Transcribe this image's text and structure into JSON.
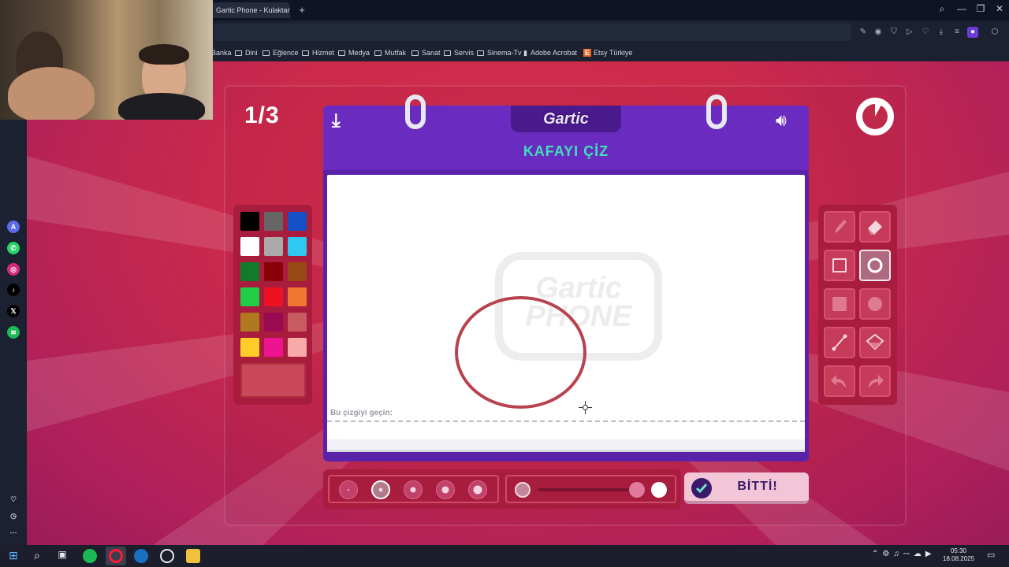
{
  "browser": {
    "tab_title": "Gartic Phone - Kulaktan K",
    "new_tab": "+",
    "bookmarks": [
      "Banka",
      "Dini",
      "Eğlence",
      "Hizmet",
      "Medya",
      "Mutfak",
      "Sanat",
      "Servis",
      "Sinema-Tv",
      "Adobe Acrobat",
      "Etsy Türkiye"
    ]
  },
  "game": {
    "round": "1/3",
    "logo": "Gartic",
    "prompt": "KAFAYI ÇİZ",
    "line_hint": "Bu çizgiyi geçin:",
    "watermark": "Gartic PHONE",
    "done_label": "BİTTİ!",
    "timer_elapsed": 0.08
  },
  "palette": {
    "colors": [
      "#000000",
      "#666666",
      "#1450c8",
      "#ffffff",
      "#aaaaaa",
      "#2ec8f0",
      "#137a2a",
      "#8a0008",
      "#984a14",
      "#22cc44",
      "#ee1122",
      "#f07830",
      "#b07820",
      "#9a0a52",
      "#c85a62",
      "#ffcc28",
      "#ee1490",
      "#f8aaa8"
    ],
    "selected": "#c9495a"
  },
  "tools": [
    "pencil",
    "eraser",
    "rect-outline",
    "ellipse-outline",
    "rect-filled",
    "ellipse-filled",
    "line",
    "fill-bucket",
    "undo",
    "redo"
  ],
  "active_tool": "ellipse-outline",
  "brush_sizes": [
    1,
    2,
    3,
    4,
    5
  ],
  "selected_size": 2,
  "opacity": 1.0,
  "taskbar": {
    "time": "05:30",
    "date": "18.08.2025"
  }
}
